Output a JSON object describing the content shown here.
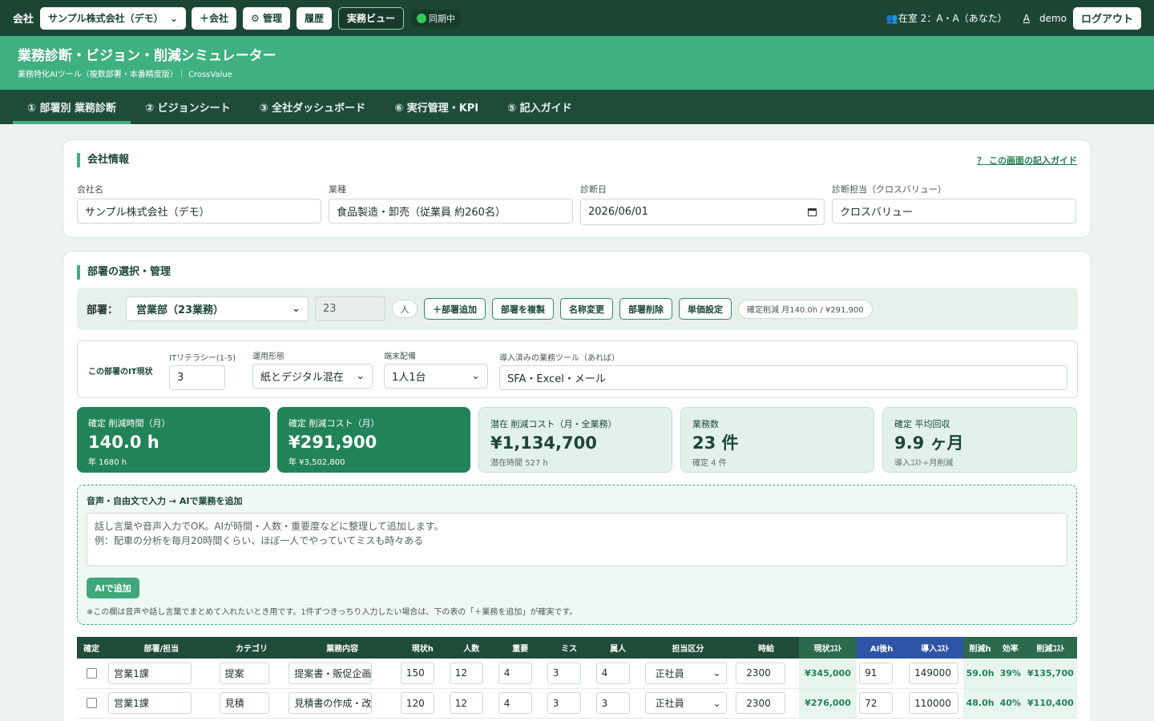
{
  "topbar": {
    "company_label": "会社",
    "company_select": "サンプル株式会社（デモ）",
    "btn_add_company": "＋会社",
    "btn_manage": "⚙ 管理",
    "btn_history": "履歴",
    "btn_practice": "実務ビュー",
    "sync_status": "同期中",
    "presence": "👥在室 2：A・A（あなた）",
    "font_toggle": "A",
    "username": "demo",
    "logout": "ログアウト"
  },
  "hero": {
    "title": "業務診断・ビジョン・削減シミュレーター",
    "subtitle": "業務特化AIツール（複数部署・本番精度版）｜ CrossValue"
  },
  "tabs": [
    "① 部署別 業務診断",
    "② ビジョンシート",
    "③ 全社ダッシュボード",
    "⑥ 実行管理・KPI",
    "⑤ 記入ガイド"
  ],
  "company_info": {
    "title": "会社情報",
    "guide_link": "？ この画面の記入ガイド",
    "fields": [
      {
        "label": "会社名",
        "value": "サンプル株式会社（デモ）"
      },
      {
        "label": "業種",
        "value": "食品製造・卸売（従業員 約260名）"
      },
      {
        "label": "診断日",
        "value": "2026/06/01"
      },
      {
        "label": "診断担当（クロスバリュー）",
        "value": "クロスバリュー"
      }
    ]
  },
  "dept": {
    "title": "部署の選択・管理",
    "dept_label": "部署：",
    "dept_select": "営業部（23業務）",
    "headcount": "23",
    "unit": "人",
    "buttons": [
      "＋部署追加",
      "部署を複製",
      "名称変更",
      "部署削除",
      "単価設定"
    ],
    "confirmed_badge": "確定削減 月140.0h / ¥291,900"
  },
  "it": {
    "label": "この部署のIT現状",
    "literacy_label": "ITリテラシー(1-5)",
    "literacy": "3",
    "ops_label": "運用形態",
    "ops": "紙とデジタル混在",
    "device_label": "端末配備",
    "device": "1人1台",
    "tools_label": "導入済みの業務ツール（あれば）",
    "tools": "SFA・Excel・メール"
  },
  "kpis": [
    {
      "label": "確定 削減時間（月）",
      "value": "140.0 h",
      "sub": "年 1680 h"
    },
    {
      "label": "確定 削減コスト（月）",
      "value": "¥291,900",
      "sub": "年 ¥3,502,800"
    },
    {
      "label": "潜在 削減コスト（月・全業務）",
      "value": "¥1,134,700",
      "sub": "潜在時間 527 h"
    },
    {
      "label": "業務数",
      "value": "23 件",
      "sub": "確定 4 件"
    },
    {
      "label": "確定 平均回収",
      "value": "9.9 ヶ月",
      "sub": "導入ｺｽﾄ÷月削減"
    }
  ],
  "ai": {
    "title": "音声・自由文で入力 → AIで業務を追加",
    "placeholder_line1": "話し言葉や音声入力でOK。AIが時間・人数・重要度などに整理して追加します。",
    "placeholder_line2": "例：配車の分析を毎月20時間くらい、ほぼ一人でやっていてミスも時々ある",
    "button": "AIで追加",
    "note": "※この欄は音声や話し言葉でまとめて入れたいとき用です。1件ずつきっちり入力したい場合は、下の表の「＋業務を追加」が確実です。"
  },
  "table": {
    "headers": [
      "確定",
      "部署/担当",
      "カテゴリ",
      "業務内容",
      "現状h",
      "人数",
      "重要",
      "ミス",
      "属人",
      "担当区分",
      "時給",
      "現状ｺｽﾄ",
      "AI後h",
      "導入ｺｽﾄ",
      "削減h",
      "効率",
      "削減ｺｽﾄ"
    ],
    "rows": [
      {
        "owner": "営業1課",
        "category": "提案",
        "task": "提案書・販促企画",
        "hours": "150",
        "people": "12",
        "importance": "4",
        "errors": "3",
        "dependency": "4",
        "role": "正社員",
        "wage": "2300",
        "cost": "¥345,000",
        "ai_hours": "91",
        "intro_cost": "149000",
        "saved_h": "59.0h",
        "eff": "39%",
        "saved_cost": "¥135,700"
      },
      {
        "owner": "営業1課",
        "category": "見積",
        "task": "見積書の作成・改",
        "hours": "120",
        "people": "12",
        "importance": "4",
        "errors": "3",
        "dependency": "3",
        "role": "正社員",
        "wage": "2300",
        "cost": "¥276,000",
        "ai_hours": "72",
        "intro_cost": "110000",
        "saved_h": "48.0h",
        "eff": "40%",
        "saved_cost": "¥110,400"
      }
    ]
  }
}
